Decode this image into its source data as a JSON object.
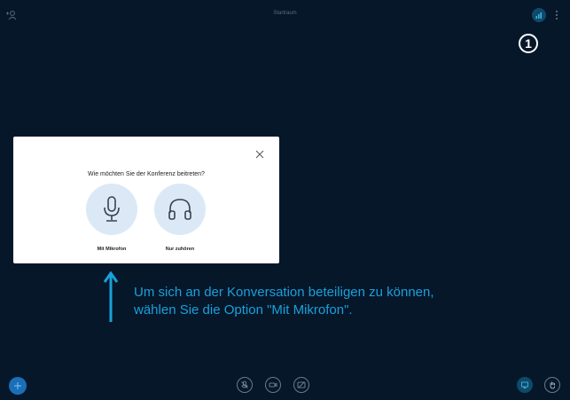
{
  "header": {
    "room_title": "Startraum"
  },
  "step_marker": "1",
  "dialog": {
    "title": "Wie möchten Sie der Konferenz beitreten?",
    "options": [
      {
        "label": "Mit Mikrofon",
        "icon": "microphone-icon"
      },
      {
        "label": "Nur zuhören",
        "icon": "headphones-icon"
      }
    ]
  },
  "hint": {
    "line1": "Um sich an der Konversation beteiligen zu können,",
    "line2": "wählen Sie die Option \"Mit Mikrofon\"."
  },
  "colors": {
    "background": "#06172a",
    "accent": "#1aa0da",
    "option_circle": "#dbe9f6",
    "primary_button": "#1a6fb8"
  }
}
